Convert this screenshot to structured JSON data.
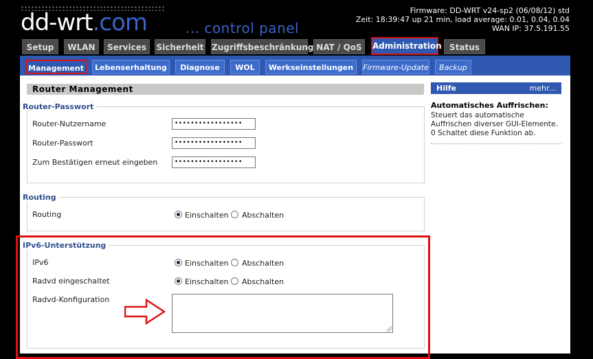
{
  "header": {
    "logo_main": "dd-wrt",
    "logo_suffix": ".com",
    "subtitle": "... control panel",
    "firmware": "Firmware: DD-WRT v24-sp2 (06/08/12) std",
    "time": "Zeit: 18:39:47 up 21 min, load average: 0.01, 0.04, 0.04",
    "wan_ip": "WAN IP: 37.5.191.55"
  },
  "main_tabs": [
    {
      "label": "Setup"
    },
    {
      "label": "WLAN"
    },
    {
      "label": "Services"
    },
    {
      "label": "Sicherheit"
    },
    {
      "label": "Zugriffsbeschränkung"
    },
    {
      "label": "NAT / QoS"
    },
    {
      "label": "Administration",
      "active": true
    },
    {
      "label": "Status"
    }
  ],
  "sub_tabs": [
    {
      "label": "Management",
      "active": true
    },
    {
      "label": "Lebenserhaltung"
    },
    {
      "label": "Diagnose"
    },
    {
      "label": "WOL"
    },
    {
      "label": "Werkseinstellungen"
    },
    {
      "label": "Firmware-Update"
    },
    {
      "label": "Backup"
    }
  ],
  "section_title": "Router Management",
  "router_password": {
    "legend": "Router-Passwort",
    "username_label": "Router-Nutzername",
    "username_value": "•••••••••••••••••",
    "password_label": "Router-Passwort",
    "password_value": "•••••••••••••••••",
    "confirm_label": "Zum Bestätigen erneut eingeben",
    "confirm_value": "•••••••••••••••••"
  },
  "routing": {
    "legend": "Routing",
    "label": "Routing",
    "on": "Einschalten",
    "off": "Abschalten"
  },
  "ipv6": {
    "legend": "IPv6-Unterstützung",
    "ipv6_label": "IPv6",
    "radvd_label": "Radvd eingeschaltet",
    "config_label": "Radvd-Konfiguration",
    "on": "Einschalten",
    "off": "Abschalten"
  },
  "help": {
    "title": "Hilfe",
    "more": "mehr...",
    "topic": "Automatisches Auffrischen:",
    "text": "Steuert das automatische Auffrischen diverser GUI-Elemente. 0 Schaltet diese Funktion ab."
  },
  "colors": {
    "accent": "#2f58b0",
    "highlight": "#dd1111"
  }
}
